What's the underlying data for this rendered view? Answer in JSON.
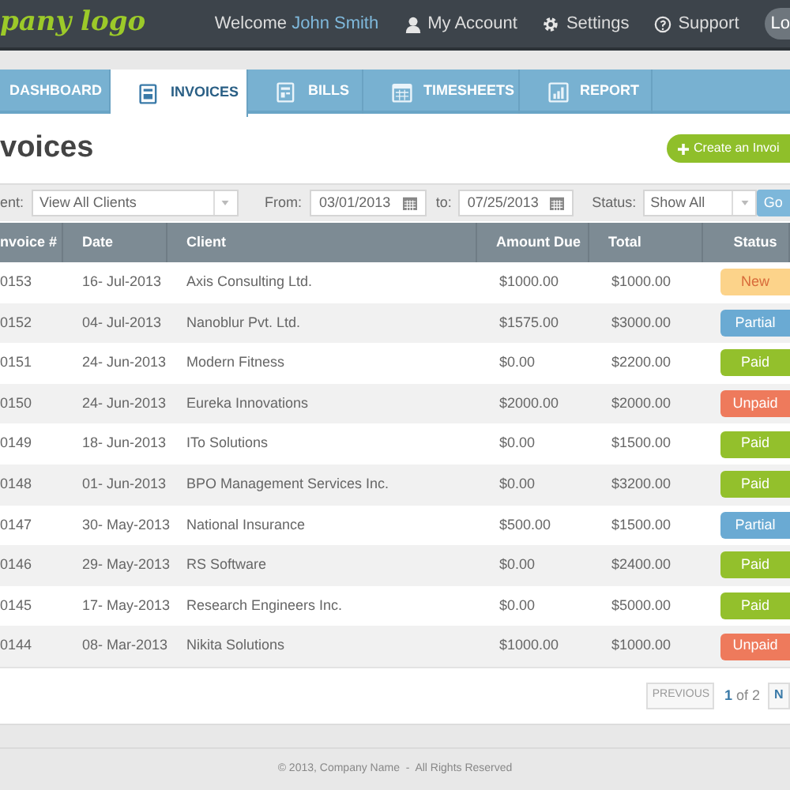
{
  "header": {
    "logo": "pany logo",
    "welcome": "Welcome",
    "user": "John Smith",
    "links": [
      {
        "label": "My Account"
      },
      {
        "label": "Settings"
      },
      {
        "label": "Support"
      }
    ],
    "logout": "Lo"
  },
  "tabs": [
    {
      "label": "DASHBOARD",
      "selected": false
    },
    {
      "label": "INVOICES",
      "selected": true
    },
    {
      "label": "BILLS",
      "selected": false
    },
    {
      "label": "TIMESHEETS",
      "selected": false
    },
    {
      "label": "REPORT",
      "selected": false
    }
  ],
  "page_title": "voices",
  "create_button": "Create an Invoi",
  "filters": {
    "client_label": "ent:",
    "client_value": "View All Clients",
    "from_label": "From:",
    "from_value": "03/01/2013",
    "to_label": "to:",
    "to_value": "07/25/2013",
    "status_label": "Status:",
    "status_value": "Show All",
    "go": "Go"
  },
  "table": {
    "columns": [
      "nvoice #",
      "Date",
      "Client",
      "Amount Due",
      "Total",
      "Status"
    ],
    "rows": [
      {
        "cells": [
          "0153",
          "16- Jul-2013",
          "Axis Consulting Ltd.",
          "$1000.00",
          "$1000.00"
        ],
        "status": "New",
        "kind": "new"
      },
      {
        "cells": [
          "0152",
          "04- Jul-2013",
          "Nanoblur Pvt. Ltd.",
          "$1575.00",
          "$3000.00"
        ],
        "status": "Partial",
        "kind": "partial"
      },
      {
        "cells": [
          "0151",
          "24- Jun-2013",
          "Modern Fitness",
          "$0.00",
          "$2200.00"
        ],
        "status": "Paid",
        "kind": "paid"
      },
      {
        "cells": [
          "0150",
          "24- Jun-2013",
          "Eureka Innovations",
          "$2000.00",
          "$2000.00"
        ],
        "status": "Unpaid",
        "kind": "unpaid"
      },
      {
        "cells": [
          "0149",
          "18- Jun-2013",
          "ITo Solutions",
          "$0.00",
          "$1500.00"
        ],
        "status": "Paid",
        "kind": "paid"
      },
      {
        "cells": [
          "0148",
          "01- Jun-2013",
          "BPO Management Services Inc.",
          "$0.00",
          "$3200.00"
        ],
        "status": "Paid",
        "kind": "paid"
      },
      {
        "cells": [
          "0147",
          "30- May-2013",
          "National Insurance",
          "$500.00",
          "$1500.00"
        ],
        "status": "Partial",
        "kind": "partial"
      },
      {
        "cells": [
          "0146",
          "29- May-2013",
          "RS Software",
          "$0.00",
          "$2400.00"
        ],
        "status": "Paid",
        "kind": "paid"
      },
      {
        "cells": [
          "0145",
          "17- May-2013",
          "Research Engineers Inc.",
          "$0.00",
          "$5000.00"
        ],
        "status": "Paid",
        "kind": "paid"
      },
      {
        "cells": [
          "0144",
          "08- Mar-2013",
          "Nikita Solutions",
          "$1000.00",
          "$1000.00"
        ],
        "status": "Unpaid",
        "kind": "unpaid"
      }
    ]
  },
  "pagination": {
    "previous": "PREVIOUS",
    "current": "1",
    "of": "of",
    "total": "2",
    "next": "N"
  },
  "footer": "© 2013, Company Name  -  All Rights Reserved"
}
